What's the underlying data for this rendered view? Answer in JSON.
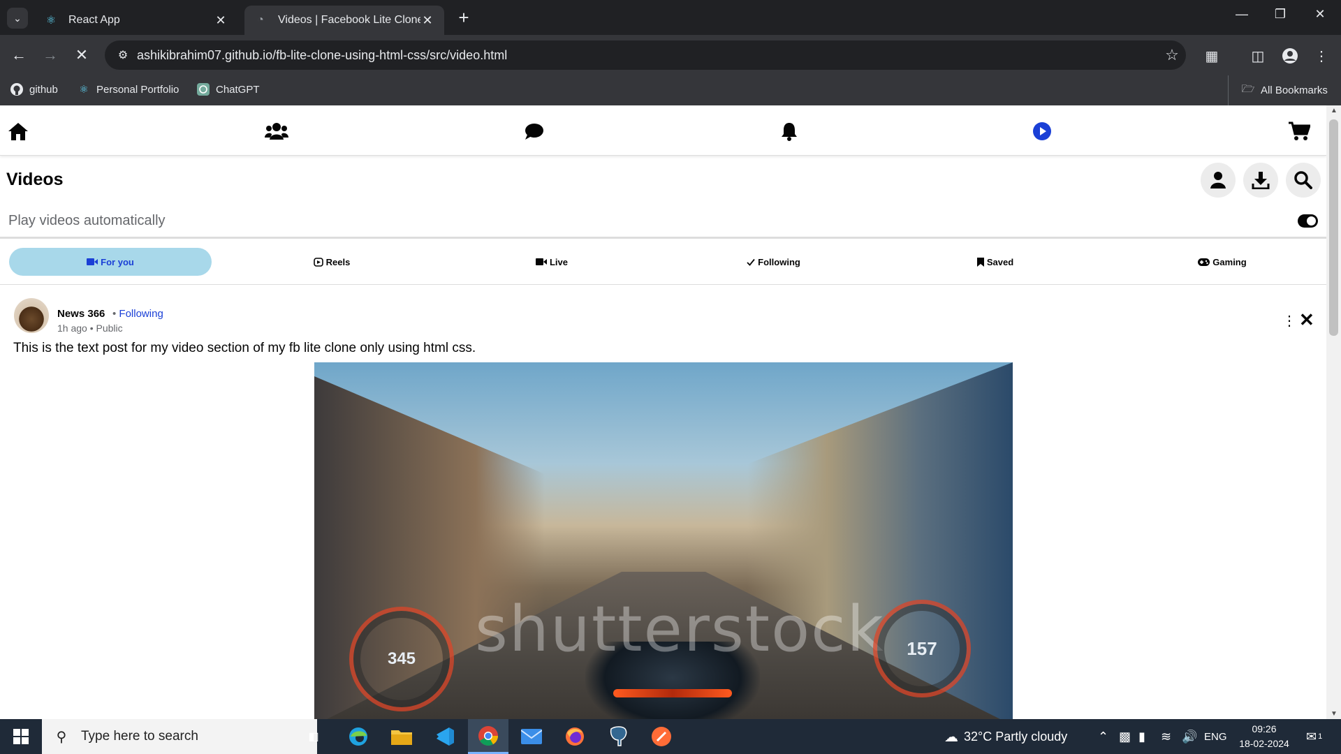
{
  "browser": {
    "tabs": [
      {
        "title": "React App",
        "active": false
      },
      {
        "title": "Videos | Facebook Lite Clone",
        "active": true
      }
    ],
    "url": "ashikibrahim07.github.io/fb-lite-clone-using-html-css/src/video.html",
    "bookmarks": [
      "github",
      "Personal Portfolio",
      "ChatGPT"
    ],
    "all_bookmarks": "All Bookmarks"
  },
  "fbnav": {
    "items": [
      "home-icon",
      "friends-icon",
      "messages-icon",
      "notifications-icon",
      "videos-icon",
      "marketplace-icon"
    ],
    "active": "videos-icon",
    "accent": "#1a3fd6"
  },
  "videos": {
    "title": "Videos",
    "autoplay_label": "Play videos automatically",
    "autoplay_on": true,
    "filters": [
      {
        "label": "For you",
        "icon": "video-camera-icon",
        "selected": true
      },
      {
        "label": "Reels",
        "icon": "reels-icon",
        "selected": false
      },
      {
        "label": "Live",
        "icon": "video-camera-icon",
        "selected": false
      },
      {
        "label": "Following",
        "icon": "check-icon",
        "selected": false
      },
      {
        "label": "Saved",
        "icon": "bookmark-icon",
        "selected": false
      },
      {
        "label": "Gaming",
        "icon": "gamepad-icon",
        "selected": false
      }
    ],
    "chip_selected_color": "#a8d8ea"
  },
  "post": {
    "author": "News 366",
    "following_label": "Following",
    "time": "1h ago",
    "privacy": "Public",
    "text": "This is the text post for my video section of my fb lite clone only using html css.",
    "watermark": "shutterstock",
    "speed_left": "345",
    "speed_right": "157"
  },
  "taskbar": {
    "search_placeholder": "Type here to search",
    "weather": "32°C  Partly cloudy",
    "language": "ENG",
    "time": "09:26",
    "date": "18-02-2024",
    "notification_count": "1"
  }
}
